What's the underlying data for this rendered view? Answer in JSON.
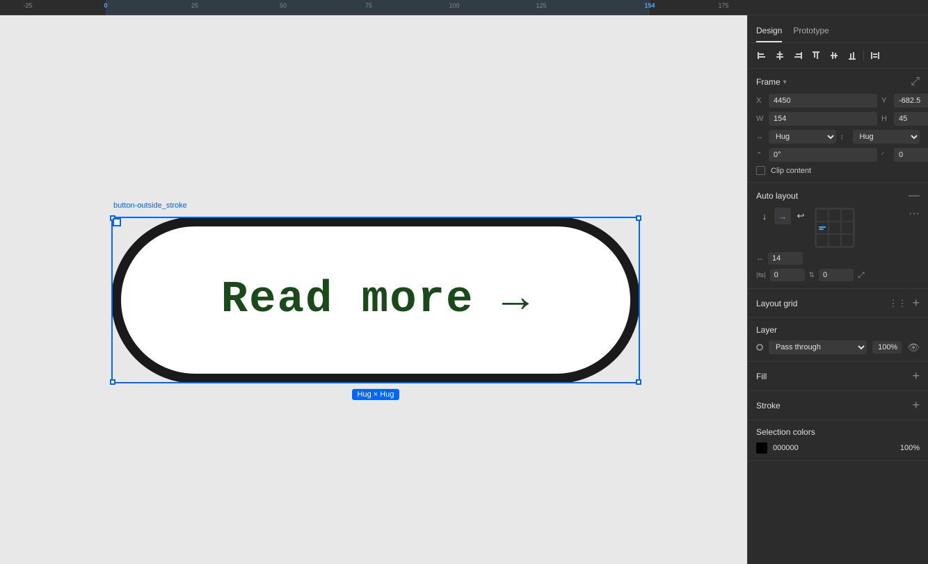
{
  "ruler": {
    "marks": [
      {
        "value": "-25",
        "pos": 40,
        "active": false
      },
      {
        "value": "0",
        "pos": 152,
        "active": true
      },
      {
        "value": "25",
        "pos": 280,
        "active": false
      },
      {
        "value": "50",
        "pos": 407,
        "active": false
      },
      {
        "value": "75",
        "pos": 530,
        "active": false
      },
      {
        "value": "100",
        "pos": 653,
        "active": false
      },
      {
        "value": "125",
        "pos": 778,
        "active": false
      },
      {
        "value": "154",
        "pos": 934,
        "active": true
      },
      {
        "value": "175",
        "pos": 1040,
        "active": false
      }
    ],
    "highlight_start": 152,
    "highlight_end": 934
  },
  "canvas": {
    "component_label": "button-outside_stroke",
    "button_text": "Read more →",
    "hug_label": "Hug × Hug"
  },
  "panel": {
    "tabs": [
      {
        "label": "Design",
        "active": true
      },
      {
        "label": "Prototype",
        "active": false
      }
    ],
    "alignment": {
      "buttons": [
        "⊞",
        "⊟",
        "⊠",
        "⊡",
        "⊢",
        "⊣",
        "⊤"
      ]
    },
    "frame": {
      "title": "Frame",
      "x_label": "X",
      "x_value": "4450",
      "y_label": "Y",
      "y_value": "-682.5",
      "w_label": "W",
      "w_value": "154",
      "h_label": "H",
      "h_value": "45",
      "hug_x": "Hug",
      "hug_y": "Hug",
      "rotation": "0°",
      "corner": "0",
      "clip_content": "Clip content"
    },
    "auto_layout": {
      "title": "Auto layout",
      "spacing": "14",
      "padding_left": "0",
      "padding_top": "0"
    },
    "layout_grid": {
      "title": "Layout grid"
    },
    "layer": {
      "title": "Layer",
      "blend_mode": "Pass through",
      "opacity": "100%"
    },
    "fill": {
      "title": "Fill"
    },
    "stroke": {
      "title": "Stroke"
    },
    "selection_colors": {
      "title": "Selection colors",
      "items": [
        {
          "color": "000000",
          "name": "000000",
          "opacity": "100%"
        }
      ]
    }
  }
}
